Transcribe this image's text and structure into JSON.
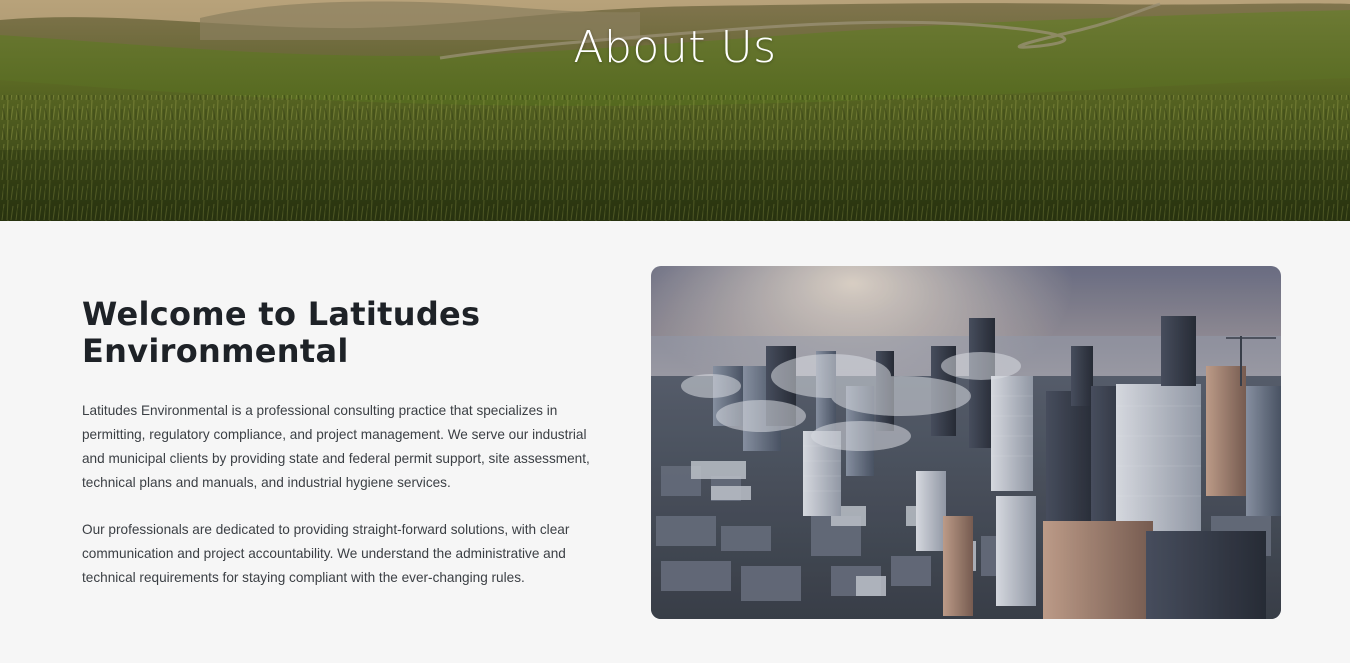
{
  "hero": {
    "title": "About Us"
  },
  "about": {
    "heading": "Welcome to Latitudes Environmental",
    "paragraph_1": "Latitudes Environmental is a professional consulting practice that specializes in permitting, regulatory compliance, and project management. We serve our industrial and municipal clients by providing state and federal permit support, site assessment, technical plans and manuals, and industrial hygiene services.",
    "paragraph_2": "Our professionals are dedicated to providing straight-forward solutions, with clear communication and project accountability. We understand the administrative and technical requirements for staying compliant with the ever-changing rules."
  },
  "colors": {
    "page_background": "#f6f6f6",
    "heading_text": "#1e2227",
    "body_text": "#3b3f44",
    "hero_title": "#ffffff"
  }
}
